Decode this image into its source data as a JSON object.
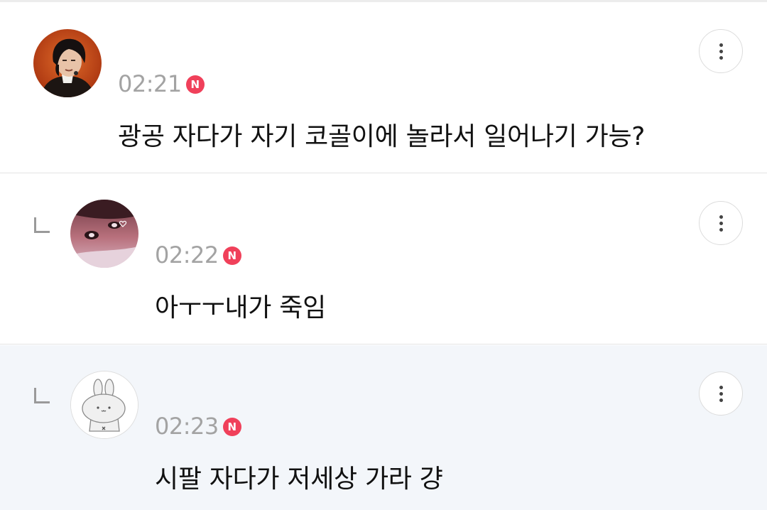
{
  "colors": {
    "badge": "#f0405a",
    "time": "#a3a3a3",
    "text": "#111111",
    "highlight_background": "#f3f6fa"
  },
  "comments": [
    {
      "time": "02:21",
      "badge": "N",
      "text": "광공 자다가 자기 코골이에 놀라서 일어나기 가능?",
      "is_reply": false,
      "avatar": "profile-photo-person-icon"
    },
    {
      "time": "02:22",
      "badge": "N",
      "text": "아ㅜㅜ내가 죽임",
      "is_reply": true,
      "avatar": "profile-photo-closeup-icon"
    },
    {
      "time": "02:23",
      "badge": "N",
      "text": "시팔 자다가 저세상 가라 걍",
      "is_reply": true,
      "highlighted": true,
      "avatar": "default-bunny-avatar-icon"
    }
  ]
}
